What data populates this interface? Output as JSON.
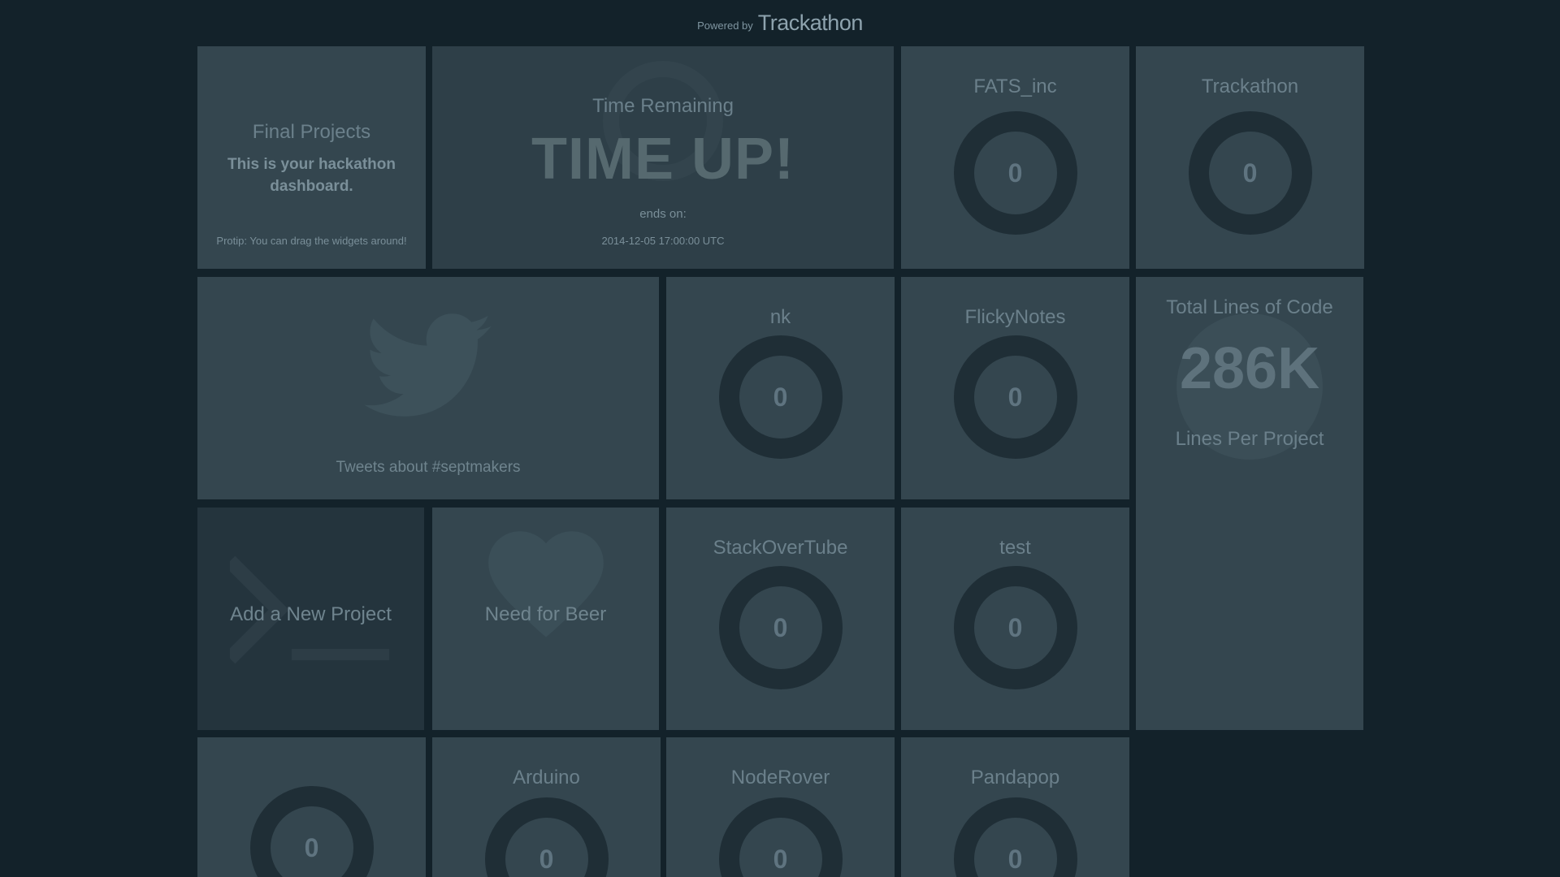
{
  "header": {
    "powered_by": "Powered by",
    "brand": "Trackathon"
  },
  "welcome": {
    "title": "Final Projects",
    "message": "This is your hackathon dashboard.",
    "protip": "Protip: You can drag the widgets around!"
  },
  "countdown": {
    "title": "Time Remaining",
    "status": "TIME UP!",
    "ends_label": "ends on:",
    "ends_value": "2014-12-05 17:00:00 UTC"
  },
  "twitter": {
    "label": "Tweets about #septmakers"
  },
  "lines_of_code": {
    "title": "Total Lines of Code",
    "value": "286K",
    "subtitle": "Lines Per Project"
  },
  "add_project": {
    "label": "Add a New Project"
  },
  "beer": {
    "label": "Need for Beer"
  },
  "projects": [
    {
      "name": "FATS_inc",
      "value": "0"
    },
    {
      "name": "Trackathon",
      "value": "0"
    },
    {
      "name": "nk",
      "value": "0"
    },
    {
      "name": "FlickyNotes",
      "value": "0"
    },
    {
      "name": "StackOverTube",
      "value": "0"
    },
    {
      "name": "test",
      "value": "0"
    },
    {
      "name": "",
      "value": "0"
    },
    {
      "name": "Arduino",
      "value": "0"
    },
    {
      "name": "NodeRover",
      "value": "0"
    },
    {
      "name": "Pandapop",
      "value": "0"
    }
  ]
}
